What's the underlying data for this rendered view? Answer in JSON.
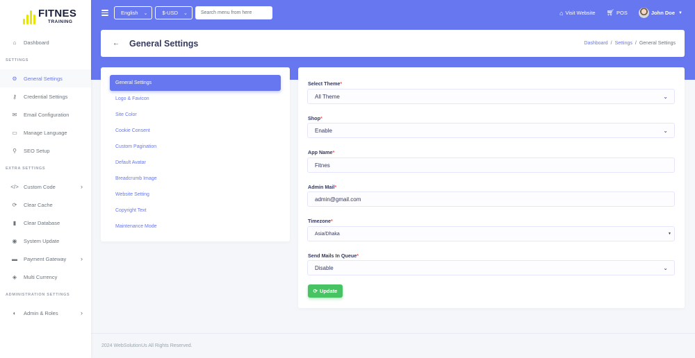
{
  "colors": {
    "primary": "#6777ef",
    "success": "#47c363",
    "logo": "#e6e60b"
  },
  "brand": {
    "name": "FITNES",
    "sub": "TRAINING"
  },
  "sidebar": {
    "dashboard": "Dashboard",
    "header_settings": "SETTINGS",
    "items_settings": [
      {
        "label": "General Settings",
        "icon": "gear-icon"
      },
      {
        "label": "Credential Settings",
        "icon": "key-icon"
      },
      {
        "label": "Email Configuration",
        "icon": "envelope-icon"
      },
      {
        "label": "Manage Language",
        "icon": "language-icon"
      },
      {
        "label": "SEO Setup",
        "icon": "search-icon"
      }
    ],
    "header_extra": "EXTRA SETTINGS",
    "items_extra": [
      {
        "label": "Custom Code",
        "icon": "code-icon"
      },
      {
        "label": "Clear Cache",
        "icon": "refresh-icon"
      },
      {
        "label": "Clear Database",
        "icon": "trash-icon"
      },
      {
        "label": "System Update",
        "icon": "update-icon"
      },
      {
        "label": "Payment Gateway",
        "icon": "credit-card-icon"
      },
      {
        "label": "Multi Currency",
        "icon": "coins-icon"
      }
    ],
    "header_admin": "ADMINISTRATION SETTINGS",
    "items_admin": [
      {
        "label": "Admin & Roles",
        "icon": "shield-icon"
      }
    ]
  },
  "topnav": {
    "language": "English",
    "currency": "$-USD",
    "search_placeholder": "Search menu from here",
    "visit_website": "Visit Website",
    "pos": "POS",
    "user": "John Doe"
  },
  "page": {
    "title": "General Settings",
    "breadcrumb": [
      "Dashboard",
      "Settings",
      "General Settings"
    ]
  },
  "settings_nav": [
    "General Settings",
    "Logo & Favicon",
    "Site Color",
    "Cookie Consent",
    "Custom Pagination",
    "Default Avatar",
    "Breadcrumb Image",
    "Website Setting",
    "Copyright Text",
    "Maintenance Mode"
  ],
  "form": {
    "theme": {
      "label": "Select Theme",
      "value": "All Theme"
    },
    "shop": {
      "label": "Shop",
      "value": "Enable"
    },
    "app_name": {
      "label": "App Name",
      "value": "Fitnes"
    },
    "admin_mail": {
      "label": "Admin Mail",
      "value": "admin@gmail.com"
    },
    "timezone": {
      "label": "Timezone",
      "value": "Asia/Dhaka"
    },
    "queue": {
      "label": "Send Mails In Queue",
      "value": "Disable"
    },
    "required_mark": "*",
    "update_label": "Update"
  },
  "footer": {
    "text": "2024 WebSolutionUs All Rights Reserved."
  }
}
